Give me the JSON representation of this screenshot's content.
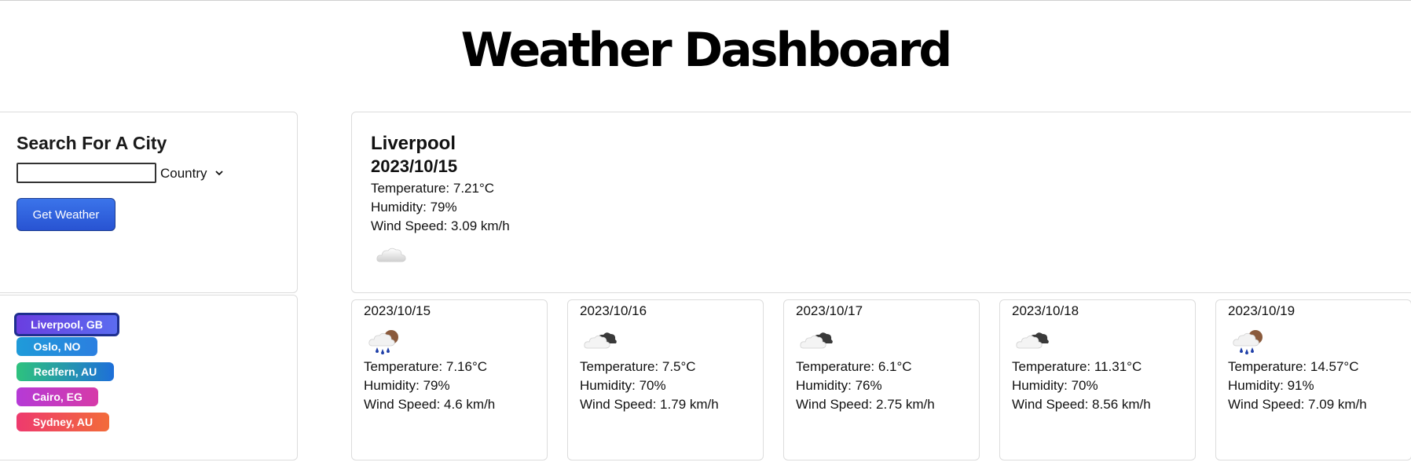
{
  "header": {
    "title": "Weather Dashboard"
  },
  "search": {
    "heading": "Search For A City",
    "city_value": "",
    "country_label": "Country",
    "button_label": "Get Weather"
  },
  "history": [
    {
      "label": "Liverpool, GB",
      "colors": [
        "#6a3ee0",
        "#5b6cf0"
      ],
      "active": true
    },
    {
      "label": "Oslo, NO",
      "colors": [
        "#1f9bd9",
        "#2b7fe0"
      ],
      "active": false
    },
    {
      "label": "Redfern, AU",
      "colors": [
        "#2ec27e",
        "#1e6fd9"
      ],
      "active": false
    },
    {
      "label": "Cairo, EG",
      "colors": [
        "#b53ad6",
        "#d63aa8"
      ],
      "active": false
    },
    {
      "label": "Sydney, AU",
      "colors": [
        "#ee3a6e",
        "#f26b3a"
      ],
      "active": false
    }
  ],
  "current": {
    "city": "Liverpool",
    "date": "2023/10/15",
    "temperature": "Temperature: 7.21°C",
    "humidity": "Humidity: 79%",
    "wind": "Wind Speed: 3.09 km/h",
    "icon": "cloud-icon"
  },
  "forecast": [
    {
      "date": "2023/10/15",
      "icon": "rain-icon",
      "temperature": "Temperature: 7.16°C",
      "humidity": "Humidity: 79%",
      "wind": "Wind Speed: 4.6 km/h"
    },
    {
      "date": "2023/10/16",
      "icon": "broken-clouds-icon",
      "temperature": "Temperature: 7.5°C",
      "humidity": "Humidity: 70%",
      "wind": "Wind Speed: 1.79 km/h"
    },
    {
      "date": "2023/10/17",
      "icon": "broken-clouds-icon",
      "temperature": "Temperature: 6.1°C",
      "humidity": "Humidity: 76%",
      "wind": "Wind Speed: 2.75 km/h"
    },
    {
      "date": "2023/10/18",
      "icon": "broken-clouds-icon",
      "temperature": "Temperature: 11.31°C",
      "humidity": "Humidity: 70%",
      "wind": "Wind Speed: 8.56 km/h"
    },
    {
      "date": "2023/10/19",
      "icon": "rain-icon",
      "temperature": "Temperature: 14.57°C",
      "humidity": "Humidity: 91%",
      "wind": "Wind Speed: 7.09 km/h"
    }
  ]
}
